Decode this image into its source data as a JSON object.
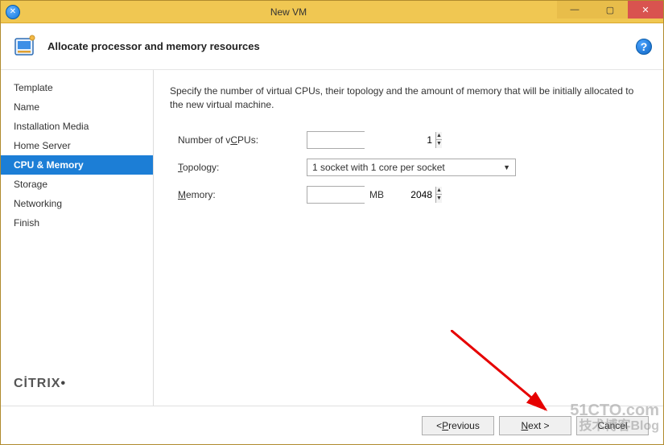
{
  "window": {
    "title": "New VM"
  },
  "header": {
    "title": "Allocate processor and memory resources"
  },
  "sidebar": {
    "steps": [
      {
        "label": "Template",
        "active": false
      },
      {
        "label": "Name",
        "active": false
      },
      {
        "label": "Installation Media",
        "active": false
      },
      {
        "label": "Home Server",
        "active": false
      },
      {
        "label": "CPU & Memory",
        "active": true
      },
      {
        "label": "Storage",
        "active": false
      },
      {
        "label": "Networking",
        "active": false
      },
      {
        "label": "Finish",
        "active": false
      }
    ],
    "brand_left": "CİTRIX",
    "brand_dot": "•"
  },
  "content": {
    "description": "Specify the number of virtual CPUs, their topology and the amount of memory that will be initially allocated to the new virtual machine.",
    "vcpus": {
      "label_pre": "Number of v",
      "label_u": "C",
      "label_post": "PUs:",
      "value": "1"
    },
    "topology": {
      "label_u": "T",
      "label_post": "opology:",
      "selected": "1 socket with 1 core per socket"
    },
    "memory": {
      "label_u": "M",
      "label_post": "emory:",
      "value": "2048",
      "unit": "MB"
    }
  },
  "footer": {
    "previous_pre": "< ",
    "previous_u": "P",
    "previous_post": "revious",
    "next_pre": "",
    "next_u": "N",
    "next_post": "ext >",
    "cancel": "Cancel"
  },
  "watermark": {
    "line1": "51CTO.com",
    "line2": "技术博客Blog"
  }
}
